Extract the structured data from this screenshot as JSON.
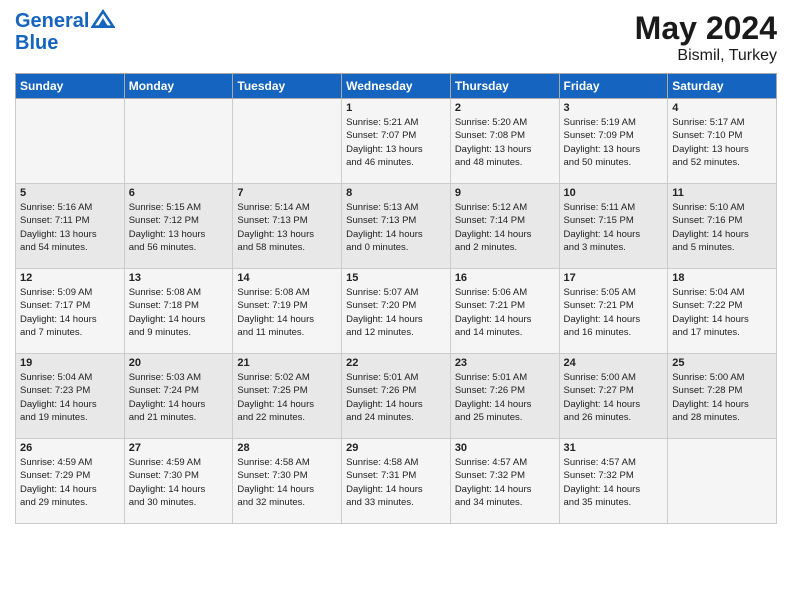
{
  "header": {
    "logo_line1": "General",
    "logo_line2": "Blue",
    "month_year": "May 2024",
    "location": "Bismil, Turkey"
  },
  "days_of_week": [
    "Sunday",
    "Monday",
    "Tuesday",
    "Wednesday",
    "Thursday",
    "Friday",
    "Saturday"
  ],
  "weeks": [
    [
      {
        "day": "",
        "info": ""
      },
      {
        "day": "",
        "info": ""
      },
      {
        "day": "",
        "info": ""
      },
      {
        "day": "1",
        "info": "Sunrise: 5:21 AM\nSunset: 7:07 PM\nDaylight: 13 hours\nand 46 minutes."
      },
      {
        "day": "2",
        "info": "Sunrise: 5:20 AM\nSunset: 7:08 PM\nDaylight: 13 hours\nand 48 minutes."
      },
      {
        "day": "3",
        "info": "Sunrise: 5:19 AM\nSunset: 7:09 PM\nDaylight: 13 hours\nand 50 minutes."
      },
      {
        "day": "4",
        "info": "Sunrise: 5:17 AM\nSunset: 7:10 PM\nDaylight: 13 hours\nand 52 minutes."
      }
    ],
    [
      {
        "day": "5",
        "info": "Sunrise: 5:16 AM\nSunset: 7:11 PM\nDaylight: 13 hours\nand 54 minutes."
      },
      {
        "day": "6",
        "info": "Sunrise: 5:15 AM\nSunset: 7:12 PM\nDaylight: 13 hours\nand 56 minutes."
      },
      {
        "day": "7",
        "info": "Sunrise: 5:14 AM\nSunset: 7:13 PM\nDaylight: 13 hours\nand 58 minutes."
      },
      {
        "day": "8",
        "info": "Sunrise: 5:13 AM\nSunset: 7:13 PM\nDaylight: 14 hours\nand 0 minutes."
      },
      {
        "day": "9",
        "info": "Sunrise: 5:12 AM\nSunset: 7:14 PM\nDaylight: 14 hours\nand 2 minutes."
      },
      {
        "day": "10",
        "info": "Sunrise: 5:11 AM\nSunset: 7:15 PM\nDaylight: 14 hours\nand 3 minutes."
      },
      {
        "day": "11",
        "info": "Sunrise: 5:10 AM\nSunset: 7:16 PM\nDaylight: 14 hours\nand 5 minutes."
      }
    ],
    [
      {
        "day": "12",
        "info": "Sunrise: 5:09 AM\nSunset: 7:17 PM\nDaylight: 14 hours\nand 7 minutes."
      },
      {
        "day": "13",
        "info": "Sunrise: 5:08 AM\nSunset: 7:18 PM\nDaylight: 14 hours\nand 9 minutes."
      },
      {
        "day": "14",
        "info": "Sunrise: 5:08 AM\nSunset: 7:19 PM\nDaylight: 14 hours\nand 11 minutes."
      },
      {
        "day": "15",
        "info": "Sunrise: 5:07 AM\nSunset: 7:20 PM\nDaylight: 14 hours\nand 12 minutes."
      },
      {
        "day": "16",
        "info": "Sunrise: 5:06 AM\nSunset: 7:21 PM\nDaylight: 14 hours\nand 14 minutes."
      },
      {
        "day": "17",
        "info": "Sunrise: 5:05 AM\nSunset: 7:21 PM\nDaylight: 14 hours\nand 16 minutes."
      },
      {
        "day": "18",
        "info": "Sunrise: 5:04 AM\nSunset: 7:22 PM\nDaylight: 14 hours\nand 17 minutes."
      }
    ],
    [
      {
        "day": "19",
        "info": "Sunrise: 5:04 AM\nSunset: 7:23 PM\nDaylight: 14 hours\nand 19 minutes."
      },
      {
        "day": "20",
        "info": "Sunrise: 5:03 AM\nSunset: 7:24 PM\nDaylight: 14 hours\nand 21 minutes."
      },
      {
        "day": "21",
        "info": "Sunrise: 5:02 AM\nSunset: 7:25 PM\nDaylight: 14 hours\nand 22 minutes."
      },
      {
        "day": "22",
        "info": "Sunrise: 5:01 AM\nSunset: 7:26 PM\nDaylight: 14 hours\nand 24 minutes."
      },
      {
        "day": "23",
        "info": "Sunrise: 5:01 AM\nSunset: 7:26 PM\nDaylight: 14 hours\nand 25 minutes."
      },
      {
        "day": "24",
        "info": "Sunrise: 5:00 AM\nSunset: 7:27 PM\nDaylight: 14 hours\nand 26 minutes."
      },
      {
        "day": "25",
        "info": "Sunrise: 5:00 AM\nSunset: 7:28 PM\nDaylight: 14 hours\nand 28 minutes."
      }
    ],
    [
      {
        "day": "26",
        "info": "Sunrise: 4:59 AM\nSunset: 7:29 PM\nDaylight: 14 hours\nand 29 minutes."
      },
      {
        "day": "27",
        "info": "Sunrise: 4:59 AM\nSunset: 7:30 PM\nDaylight: 14 hours\nand 30 minutes."
      },
      {
        "day": "28",
        "info": "Sunrise: 4:58 AM\nSunset: 7:30 PM\nDaylight: 14 hours\nand 32 minutes."
      },
      {
        "day": "29",
        "info": "Sunrise: 4:58 AM\nSunset: 7:31 PM\nDaylight: 14 hours\nand 33 minutes."
      },
      {
        "day": "30",
        "info": "Sunrise: 4:57 AM\nSunset: 7:32 PM\nDaylight: 14 hours\nand 34 minutes."
      },
      {
        "day": "31",
        "info": "Sunrise: 4:57 AM\nSunset: 7:32 PM\nDaylight: 14 hours\nand 35 minutes."
      },
      {
        "day": "",
        "info": ""
      }
    ]
  ]
}
